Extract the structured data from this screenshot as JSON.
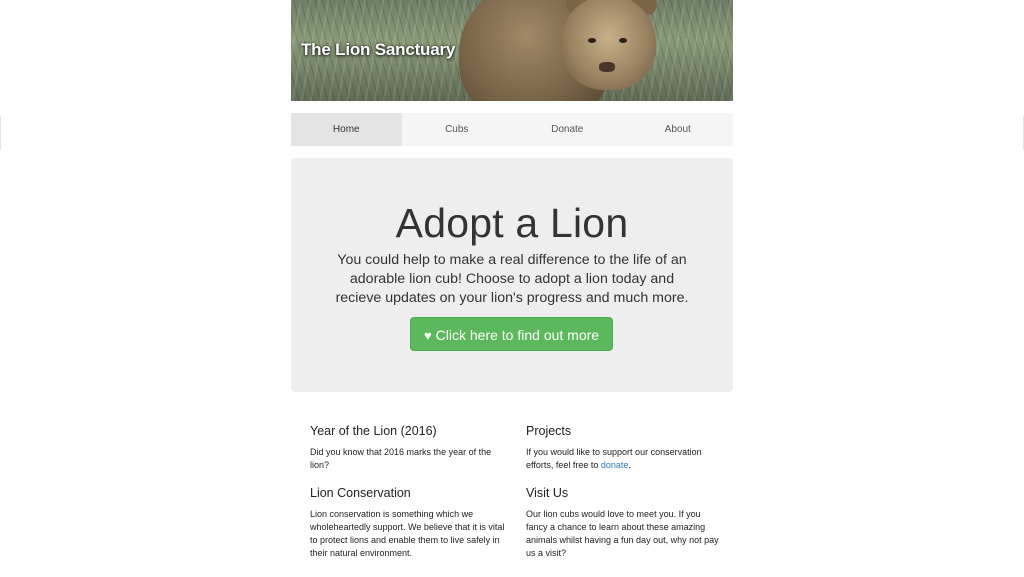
{
  "header": {
    "site_title": "The Lion Sanctuary"
  },
  "nav": {
    "items": [
      {
        "label": "Home",
        "active": true
      },
      {
        "label": "Cubs",
        "active": false
      },
      {
        "label": "Donate",
        "active": false
      },
      {
        "label": "About",
        "active": false
      }
    ]
  },
  "hero": {
    "headline": "Adopt a Lion",
    "lead": "You could help to make a real difference to the life of an adorable lion cub! Choose to adopt a lion today and recieve updates on your lion's progress and much more.",
    "cta_label": "Click here to find out more",
    "cta_icon": "heart-icon",
    "cta_color": "#5cb85c"
  },
  "sections": [
    {
      "title": "Year of the Lion (2016)",
      "text": "Did you know that 2016 marks the year of the lion?"
    },
    {
      "title": "Projects",
      "text": "If you would like to support our conservation efforts, feel free to ",
      "link": "donate",
      "text_after": "."
    },
    {
      "title": "Lion Conservation",
      "text": "Lion conservation is something which we wholeheartedly support. We believe that it is vital to protect lions and enable them to live safely in their natural environment."
    },
    {
      "title": "Visit Us",
      "text": "Our lion cubs would love to meet you. If you fancy a chance to learn about these amazing animals whilst having a fun day out, why not pay us a visit?"
    }
  ]
}
